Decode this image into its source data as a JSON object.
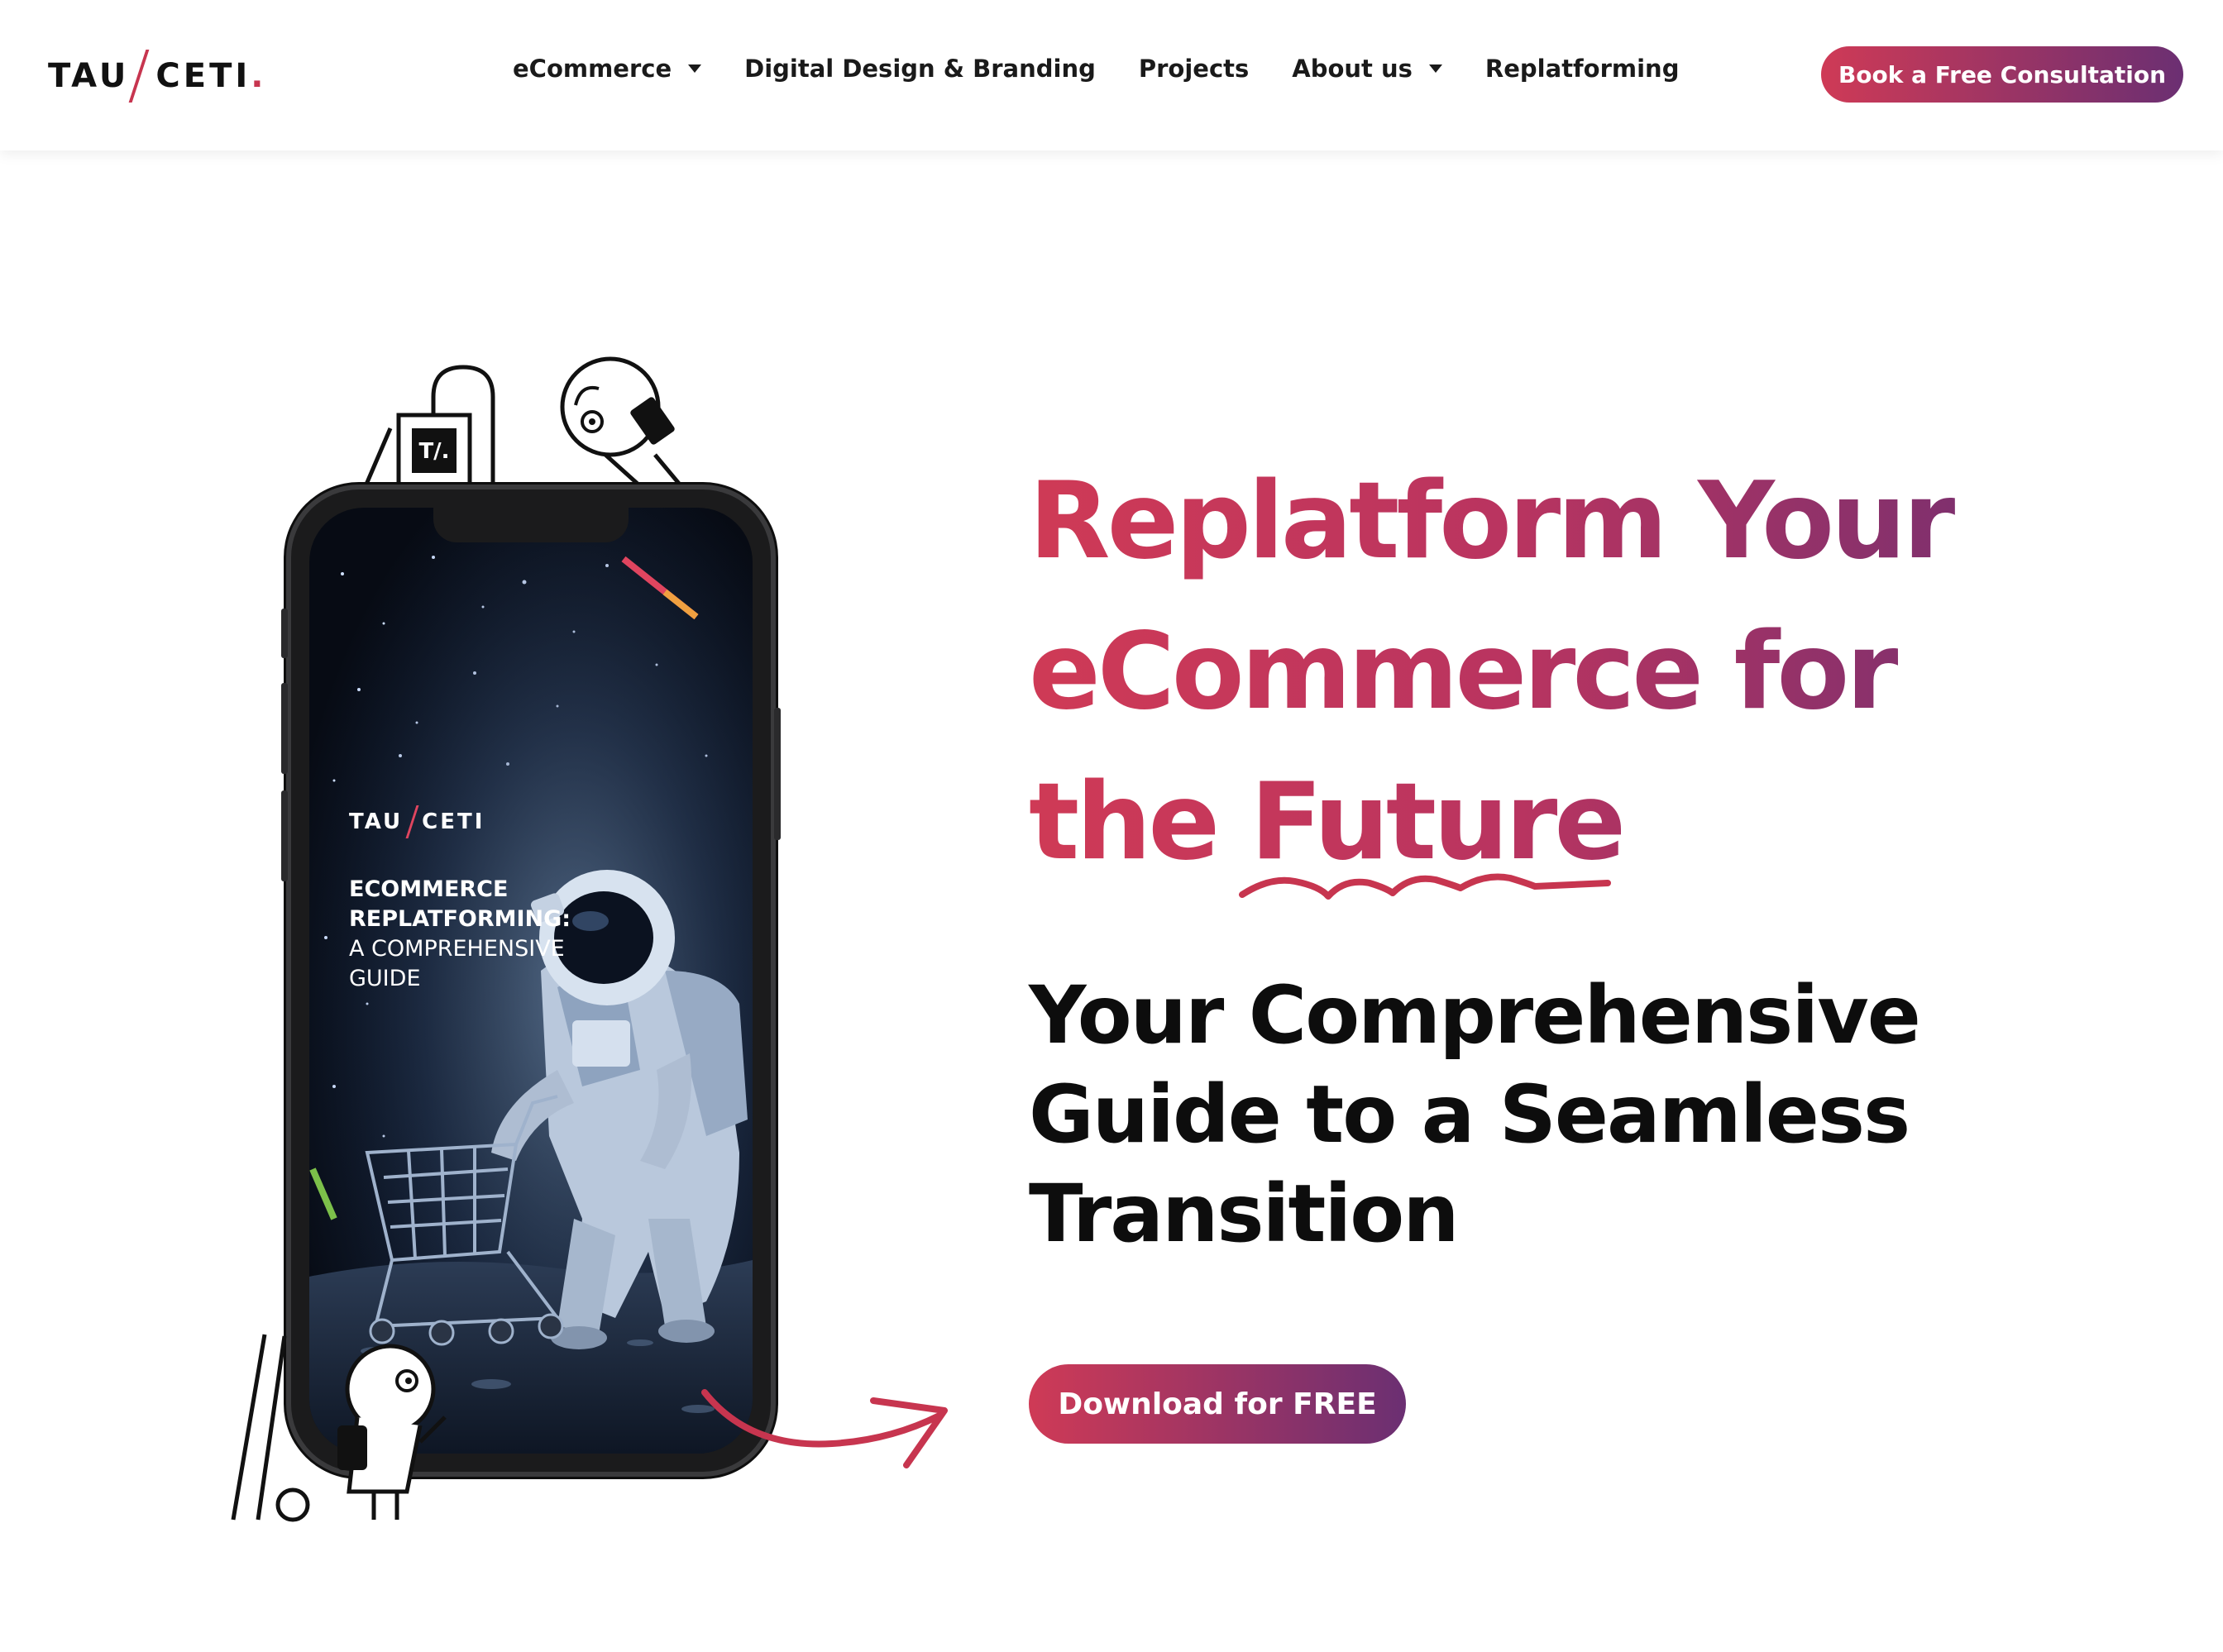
{
  "header": {
    "logo": {
      "left": "TAU",
      "right": "CETI",
      "dot": "."
    },
    "nav": [
      {
        "label": "eCommerce",
        "has_dropdown": true
      },
      {
        "label": "Digital Design & Branding",
        "has_dropdown": false
      },
      {
        "label": "Projects",
        "has_dropdown": false
      },
      {
        "label": "About us",
        "has_dropdown": true
      },
      {
        "label": "Replatforming",
        "has_dropdown": false
      }
    ],
    "cta_label": "Book a Free Consultation"
  },
  "hero": {
    "title_lines": [
      "Replatform Your",
      "eCommerce for",
      "the Future"
    ],
    "subtitle_lines": [
      "Your Comprehensive",
      "Guide to a Seamless",
      "Transition"
    ],
    "download_label": "Download for FREE"
  },
  "ebook": {
    "logo_left": "TAU",
    "logo_right": "CETI",
    "title_bold": [
      "ECOMMERCE",
      "REPLATFORMING:"
    ],
    "title_normal": [
      "A COMPREHENSIVE",
      "GUIDE"
    ]
  },
  "colors": {
    "accent_start": "#cf3a56",
    "accent_end": "#6b2f72",
    "text_dark": "#0d0d0d"
  },
  "icons": [
    "shopping-bag-icon",
    "astronaut-helmet-doodle",
    "character-doodle",
    "curved-arrow-icon",
    "dropdown-caret-icon"
  ]
}
